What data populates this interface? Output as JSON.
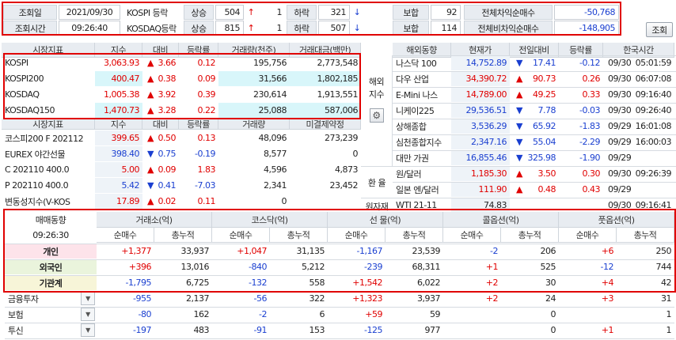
{
  "top": {
    "date_label": "조회일",
    "date": "2021/09/30",
    "time_label": "조회시간",
    "time": "09:26:40",
    "rows": [
      {
        "market": "KOSPI 등락",
        "up_label": "상승",
        "up": "504",
        "up_sym": "↑",
        "up_n": "1",
        "down_label": "하락",
        "down": "321",
        "down_sym": "↓",
        "down_n": "",
        "flat_label": "보합",
        "flat": "92",
        "arb_label": "전체차익순매수",
        "arb": "-50,768"
      },
      {
        "market": "KOSDAQ등락",
        "up_label": "상승",
        "up": "815",
        "up_sym": "↑",
        "up_n": "1",
        "down_label": "하락",
        "down": "507",
        "down_sym": "↓",
        "down_n": "",
        "flat_label": "보합",
        "flat": "114",
        "arb_label": "전체비차익순매수",
        "arb": "-148,905"
      }
    ],
    "query_btn": "조회"
  },
  "market": {
    "headers": [
      "시장지표",
      "지수",
      "대비",
      "등락률",
      "거래량(천주)",
      "거래대금(백만)"
    ],
    "rows": [
      {
        "name": "KOSPI",
        "idx": "3,063.93",
        "sym": "▲",
        "diff": "3.66",
        "rate": "0.12",
        "vol": "195,756",
        "amt": "2,773,548",
        "hl": false
      },
      {
        "name": "KOSPI200",
        "idx": "400.47",
        "sym": "▲",
        "diff": "0.38",
        "rate": "0.09",
        "vol": "31,566",
        "amt": "1,802,185",
        "hl": true
      },
      {
        "name": "KOSDAQ",
        "idx": "1,005.38",
        "sym": "▲",
        "diff": "3.92",
        "rate": "0.39",
        "vol": "230,614",
        "amt": "1,913,551",
        "hl": false
      },
      {
        "name": "KOSDAQ150",
        "idx": "1,470.73",
        "sym": "▲",
        "diff": "3.28",
        "rate": "0.22",
        "vol": "25,088",
        "amt": "587,006",
        "hl": true
      }
    ],
    "headers2": [
      "시장지표",
      "지수",
      "대비",
      "등락률",
      "거래량",
      "미결제약정"
    ],
    "rows2": [
      {
        "name": "코스피200 F 202112",
        "idx": "399.65",
        "sym": "▲",
        "diff": "0.50",
        "rate": "0.13",
        "vol": "48,096",
        "amt": "273,239",
        "dir": "up"
      },
      {
        "name": "EUREX 야간선물",
        "idx": "398.40",
        "sym": "▼",
        "diff": "0.75",
        "rate": "-0.19",
        "vol": "8,577",
        "amt": "0",
        "dir": "dn"
      },
      {
        "name": "C 202110 400.0",
        "idx": "5.00",
        "sym": "▲",
        "diff": "0.09",
        "rate": "1.83",
        "vol": "4,596",
        "amt": "4,873",
        "dir": "up"
      },
      {
        "name": "P 202110 400.0",
        "idx": "5.42",
        "sym": "▼",
        "diff": "0.41",
        "rate": "-7.03",
        "vol": "2,341",
        "amt": "23,452",
        "dir": "dn"
      },
      {
        "name": "변동성지수(V-KOS",
        "idx": "17.89",
        "sym": "▲",
        "diff": "0.02",
        "rate": "0.11",
        "vol": "0",
        "amt": "",
        "dir": "up"
      }
    ]
  },
  "world": {
    "headers": [
      "해외동향",
      "현재가",
      "전일대비",
      "등락률",
      "한국시간"
    ],
    "side_overseas": "해외\n지수",
    "side_fx": "환 율",
    "side_raw": "원자재",
    "rows": [
      {
        "name": "나스닥 100",
        "price": "14,752.89",
        "sym": "▼",
        "diff": "17.41",
        "rate": "-0.12",
        "date": "09/30",
        "time": "05:01:59",
        "dir": "dn"
      },
      {
        "name": "다우 산업",
        "price": "34,390.72",
        "sym": "▲",
        "diff": "90.73",
        "rate": "0.26",
        "date": "09/30",
        "time": "06:07:08",
        "dir": "up"
      },
      {
        "name": "E-Mini 나스",
        "price": "14,789.00",
        "sym": "▲",
        "diff": "49.25",
        "rate": "0.33",
        "date": "09/30",
        "time": "09:16:40",
        "dir": "up"
      },
      {
        "name": "니케이225",
        "price": "29,536.51",
        "sym": "▼",
        "diff": "7.78",
        "rate": "-0.03",
        "date": "09/30",
        "time": "09:26:40",
        "dir": "dn"
      },
      {
        "name": "상해종합",
        "price": "3,536.29",
        "sym": "▼",
        "diff": "65.92",
        "rate": "-1.83",
        "date": "09/29",
        "time": "16:01:08",
        "dir": "dn"
      },
      {
        "name": "심천종합지수",
        "price": "2,347.16",
        "sym": "▼",
        "diff": "55.04",
        "rate": "-2.29",
        "date": "09/29",
        "time": "16:00:03",
        "dir": "dn"
      },
      {
        "name": "대만 가권",
        "price": "16,855.46",
        "sym": "▼",
        "diff": "325.98",
        "rate": "-1.90",
        "date": "09/29",
        "time": "",
        "dir": "dn"
      },
      {
        "name": "원/달러",
        "price": "1,185.30",
        "sym": "▲",
        "diff": "3.50",
        "rate": "0.30",
        "date": "09/30",
        "time": "09:26:39",
        "dir": "up"
      },
      {
        "name": "일본 엔/달러",
        "price": "111.90",
        "sym": "▲",
        "diff": "0.48",
        "rate": "0.43",
        "date": "09/29",
        "time": "",
        "dir": "up"
      },
      {
        "name": "WTI 21-11",
        "price": "74.83",
        "sym": "",
        "diff": "",
        "rate": "",
        "date": "09/30",
        "time": "09:16:41",
        "dir": "blk"
      }
    ]
  },
  "trade": {
    "title": "매매동향",
    "time": "09:26:30",
    "groups": [
      "거래소(억)",
      "코스닥(억)",
      "선 물(억)",
      "콜옵션(억)",
      "풋옵션(억)"
    ],
    "sub": [
      "순매수",
      "총누적"
    ],
    "rows": [
      {
        "name": "개인",
        "v": [
          "+1,377",
          "33,937",
          "+1,047",
          "31,135",
          "-1,167",
          "23,539",
          "-2",
          "206",
          "+6",
          "250"
        ],
        "hl": true,
        "bg": "#fde3ea"
      },
      {
        "name": "외국인",
        "v": [
          "+396",
          "13,016",
          "-840",
          "5,212",
          "-239",
          "68,311",
          "+1",
          "525",
          "-12",
          "744"
        ],
        "hl": true,
        "bg": "#eaf4dc"
      },
      {
        "name": "기관계",
        "v": [
          "-1,795",
          "6,725",
          "-132",
          "558",
          "+1,542",
          "6,022",
          "+2",
          "30",
          "+4",
          "42"
        ],
        "hl": true,
        "bg": "#f7f5d8"
      },
      {
        "name": "금융투자",
        "v": [
          "-955",
          "2,137",
          "-56",
          "322",
          "+1,323",
          "3,937",
          "+2",
          "24",
          "+3",
          "31"
        ],
        "hl": false,
        "dd": true
      },
      {
        "name": "보험",
        "v": [
          "-80",
          "162",
          "-2",
          "6",
          "+59",
          "59",
          "",
          "0",
          "",
          "1"
        ],
        "hl": false,
        "dd": true
      },
      {
        "name": "투신",
        "v": [
          "-197",
          "483",
          "-91",
          "153",
          "-125",
          "977",
          "",
          "0",
          "+1",
          "1"
        ],
        "hl": false,
        "dd": true
      }
    ]
  },
  "icons": {
    "settings": "gear-icon",
    "dropdown": "chevron-down-icon",
    "scroll": "scroll-arrow-icon"
  },
  "colors": {
    "up": "#e00000",
    "down": "#1a3fd0",
    "highlight": "#e00000"
  }
}
